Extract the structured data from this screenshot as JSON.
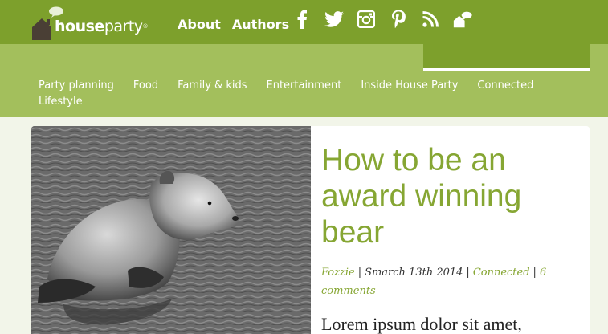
{
  "header": {
    "logo": {
      "word_house": "house",
      "word_party": "party",
      "mark": "®"
    },
    "nav": [
      {
        "label": "About"
      },
      {
        "label": "Authors"
      }
    ],
    "social": [
      {
        "icon": "facebook-icon"
      },
      {
        "icon": "twitter-icon"
      },
      {
        "icon": "instagram-icon"
      },
      {
        "icon": "pinterest-icon"
      },
      {
        "icon": "rss-icon"
      },
      {
        "icon": "houseparty-app-icon"
      }
    ]
  },
  "categories": [
    {
      "label": "Party planning"
    },
    {
      "label": "Food"
    },
    {
      "label": "Family & kids"
    },
    {
      "label": "Entertainment"
    },
    {
      "label": "Inside House Party"
    },
    {
      "label": "Connected"
    },
    {
      "label": "Lifestyle"
    }
  ],
  "article": {
    "title": "How to be an award winning bear",
    "author": "Fozzie",
    "date": "Smarch 13th 2014",
    "category": "Connected",
    "comments": "6 comments",
    "excerpt": "Lorem ipsum dolor sit amet,"
  },
  "colors": {
    "header_green": "#7da02c",
    "band_green": "#a3bf5c",
    "title_green": "#86a633",
    "page_bg": "#f2f5e9"
  }
}
